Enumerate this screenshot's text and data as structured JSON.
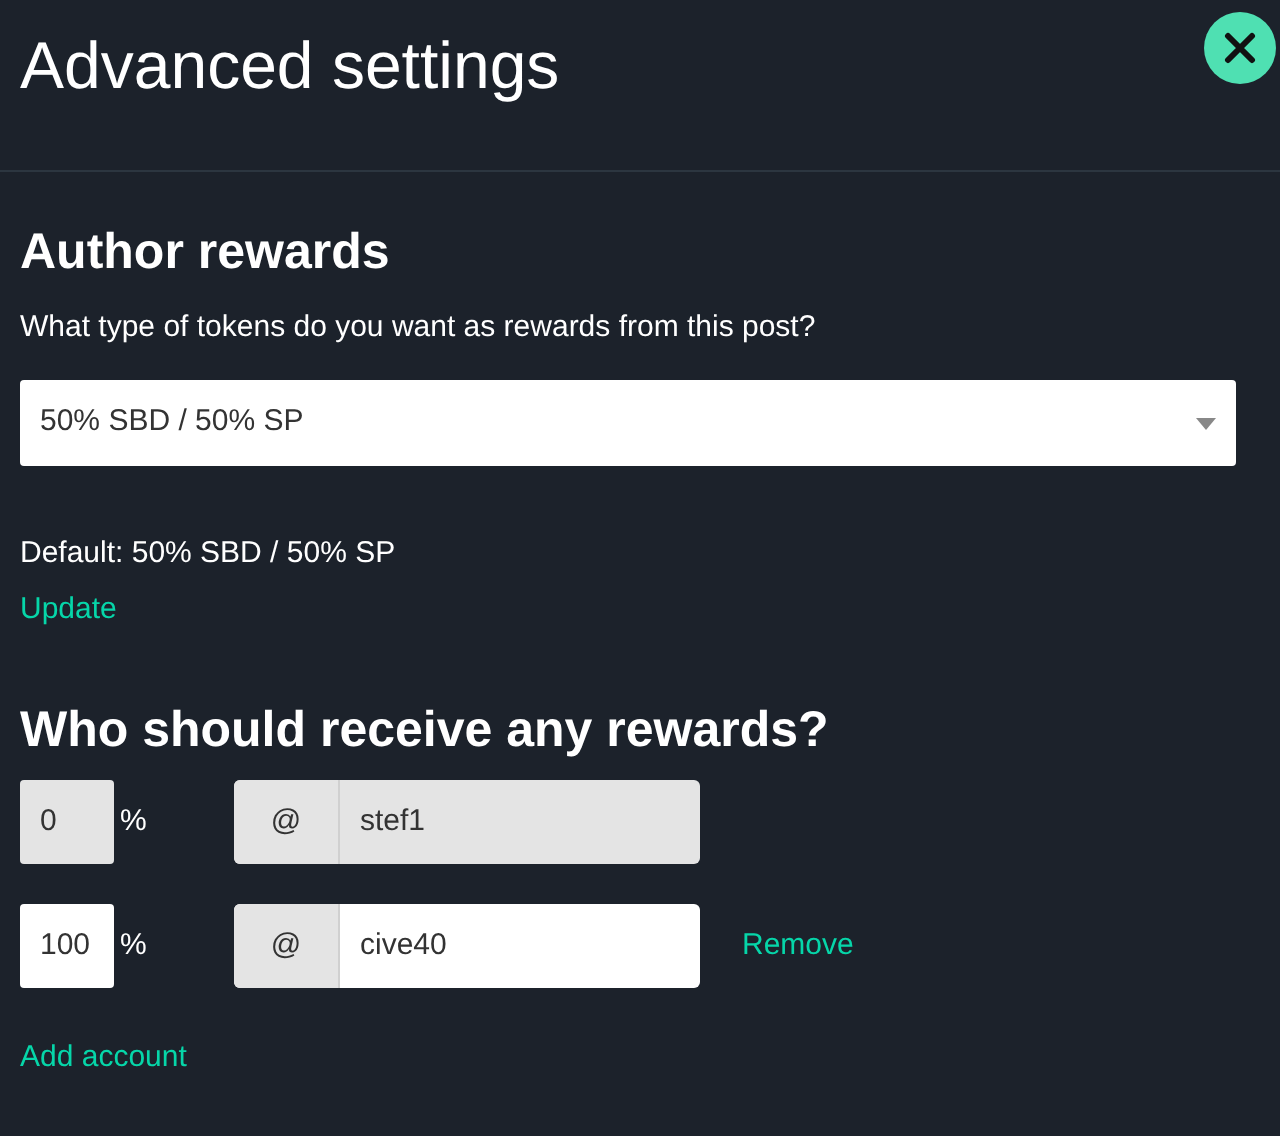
{
  "title": "Advanced settings",
  "author_rewards": {
    "heading": "Author rewards",
    "question": "What type of tokens do you want as rewards from this post?",
    "select": {
      "value": "50% SBD / 50% SP"
    },
    "default_text": "Default: 50% SBD / 50% SP",
    "update_link": "Update"
  },
  "beneficiaries": {
    "heading": "Who should receive any rewards?",
    "rows": [
      {
        "percent": "0",
        "percent_sign": "%",
        "at": "@",
        "account": "stef1",
        "disabled": true
      },
      {
        "percent": "100",
        "percent_sign": "%",
        "at": "@",
        "account": "cive40",
        "disabled": false,
        "remove_link": "Remove"
      }
    ],
    "add_link": "Add account"
  }
}
